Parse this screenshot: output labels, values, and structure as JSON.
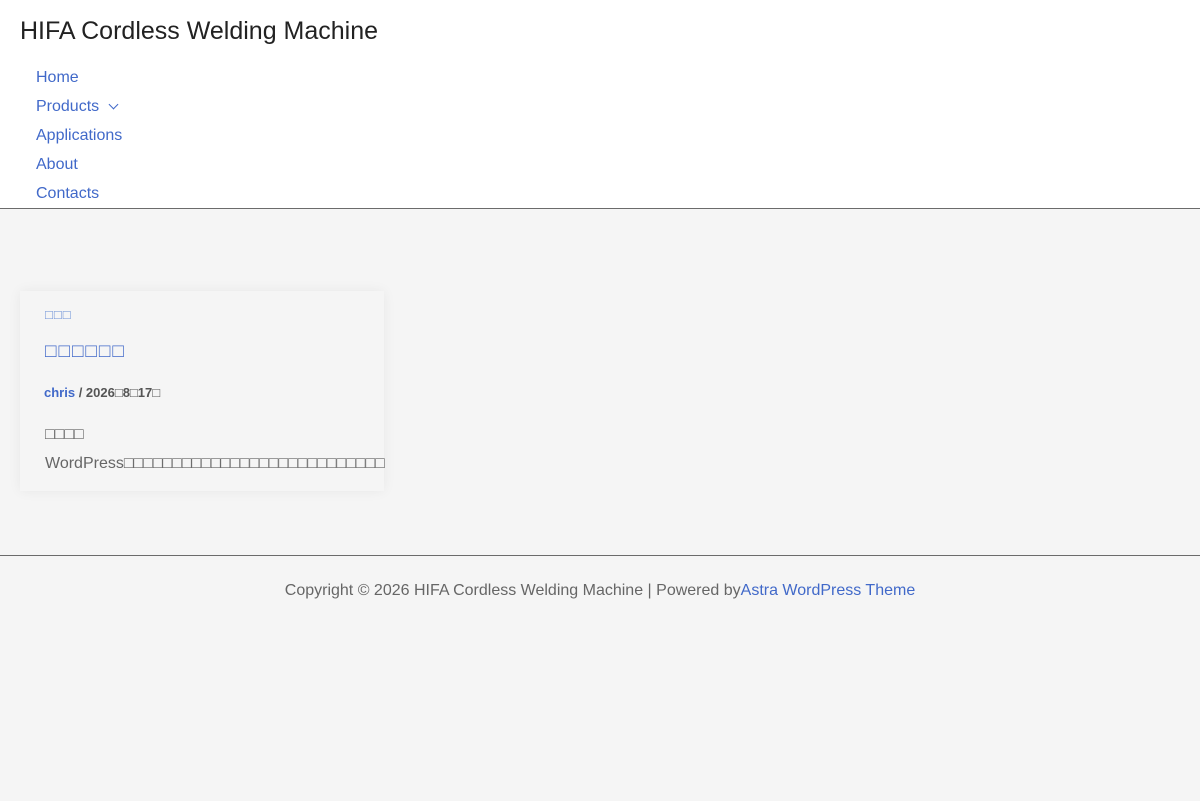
{
  "header": {
    "site_title": "HIFA Cordless Welding Machine",
    "nav": [
      {
        "label": "Home"
      },
      {
        "label": "Products",
        "has_submenu": true
      },
      {
        "label": "Applications"
      },
      {
        "label": "About"
      },
      {
        "label": "Contacts"
      }
    ]
  },
  "post": {
    "category": "□□□",
    "title": "□□□□□□",
    "author": "chris",
    "separator": " / ",
    "date": "2026□8□17□",
    "excerpt": "□□□□ WordPress□□□□□□□□□□□□□□□□□□□□□□□□□□□"
  },
  "footer": {
    "copyright": "Copyright © 2026 HIFA Cordless Welding Machine | Powered by",
    "theme_link": "Astra WordPress Theme"
  },
  "colors": {
    "link": "#4169c9",
    "background": "#f5f5f5",
    "header_bg": "#ffffff"
  }
}
